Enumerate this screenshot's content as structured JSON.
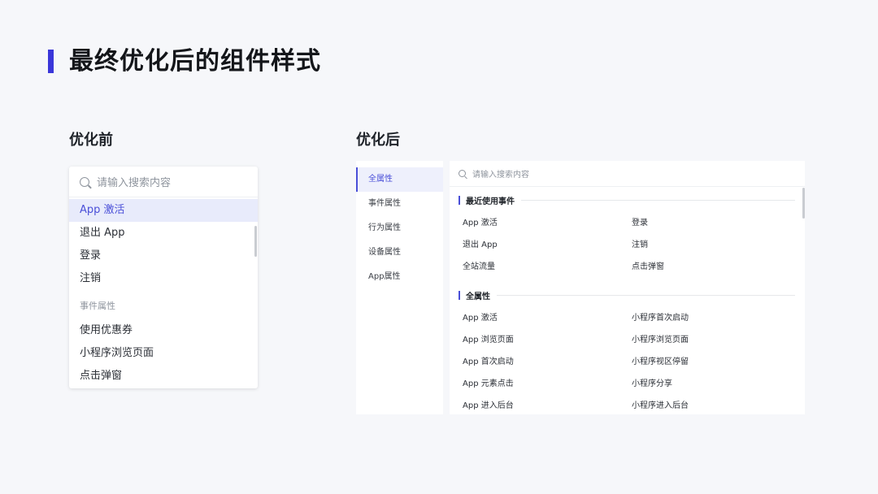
{
  "page": {
    "title": "最终优化后的组件样式",
    "accent_color": "#3a36d9"
  },
  "before": {
    "label": "优化前",
    "search_placeholder": "请输入搜索内容",
    "items": [
      {
        "label": "App 激活",
        "active": true
      },
      {
        "label": "退出 App"
      },
      {
        "label": "登录"
      },
      {
        "label": "注销"
      }
    ],
    "group_label": "事件属性",
    "group_items": [
      "使用优惠券",
      "小程序浏览页面",
      "点击弹窗"
    ]
  },
  "after": {
    "label": "优化后",
    "sidebar": [
      "全属性",
      "事件属性",
      "行为属性",
      "设备属性",
      "App属性"
    ],
    "sidebar_active_index": 0,
    "search_placeholder": "请输入搜索内容",
    "recent": {
      "title": "最近使用事件",
      "items": [
        "App 激活",
        "登录",
        "退出 App",
        "注销",
        "全站流量",
        "点击弹窗"
      ]
    },
    "all": {
      "title": "全属性",
      "items": [
        "App 激活",
        "小程序首次启动",
        "App 浏览页面",
        "小程序浏览页面",
        "App 首次启动",
        "小程序视区停留",
        "App 元素点击",
        "小程序分享",
        "App 进入后台",
        "小程序进入后台"
      ]
    }
  }
}
